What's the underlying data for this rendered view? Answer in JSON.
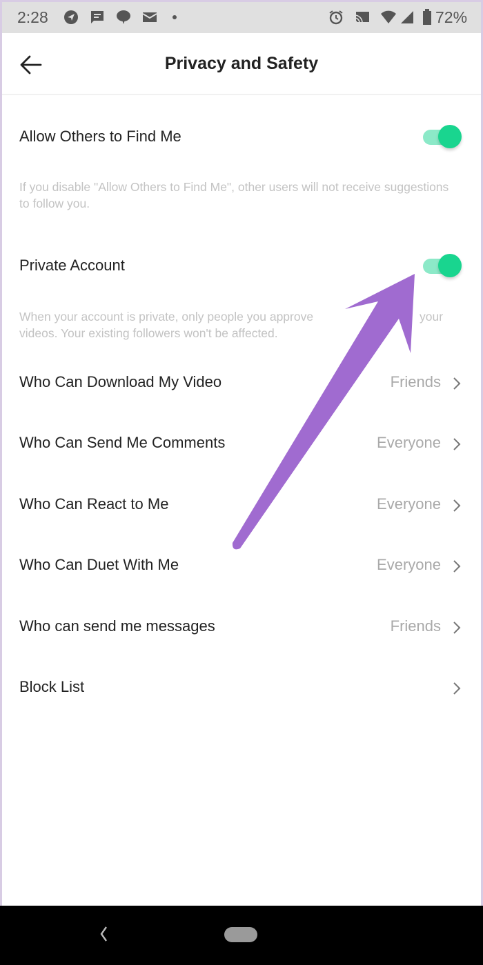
{
  "status_bar": {
    "time": "2:28",
    "left_icons": [
      "location-nav-icon",
      "message-icon",
      "chat-bubble-icon",
      "mail-icon",
      "dot-icon"
    ],
    "right_icons": [
      "alarm-icon",
      "cast-icon",
      "wifi-icon",
      "signal-icon",
      "battery-icon"
    ],
    "battery_percent": "72%"
  },
  "header": {
    "back_icon": "arrow-left-icon",
    "title": "Privacy and Safety"
  },
  "toggles": [
    {
      "label": "Allow Others to Find Me",
      "on": true,
      "description": "If you disable \"Allow Others to Find Me\", other users will not receive suggestions to follow you."
    },
    {
      "label": "Private Account",
      "on": true,
      "description_line1_left": "When your account is private, only people you approve",
      "description_line1_right": "your",
      "description_line2": "videos. Your existing followers won't be affected."
    }
  ],
  "settings": [
    {
      "label": "Who Can Download My Video",
      "value": "Friends"
    },
    {
      "label": "Who Can Send Me Comments",
      "value": "Everyone"
    },
    {
      "label": "Who Can React to Me",
      "value": "Everyone"
    },
    {
      "label": "Who Can Duet With Me",
      "value": "Everyone"
    },
    {
      "label": "Who can send me messages",
      "value": "Friends"
    },
    {
      "label": "Block List",
      "value": ""
    }
  ],
  "colors": {
    "toggle_on": "#19d58f",
    "toggle_track": "#8ce9c8",
    "annotation_arrow": "#a06bd0"
  },
  "annotation": {
    "type": "arrow",
    "points_to": "Private Account toggle"
  }
}
